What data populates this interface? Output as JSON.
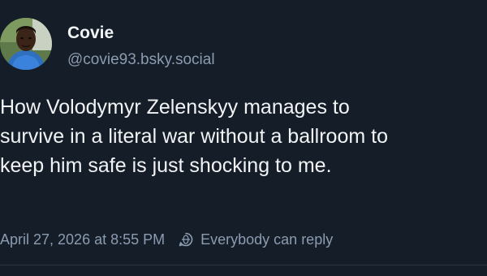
{
  "post": {
    "author": {
      "display_name": "Covie",
      "handle": "@covie93.bsky.social"
    },
    "text_lines": [
      "How Volodymyr Zelenskyy manages to",
      "survive in a literal war without a ballroom to",
      "keep him safe is just shocking to me."
    ],
    "timestamp": "April 27, 2026 at 8:55 PM",
    "reply_setting": "Everybody can reply"
  },
  "icons": {
    "reply_setting_icon": "globe-chat-icon"
  },
  "colors": {
    "background": "#151e28",
    "text_primary": "#f1f3f5",
    "text_secondary": "#8b9bb0"
  }
}
